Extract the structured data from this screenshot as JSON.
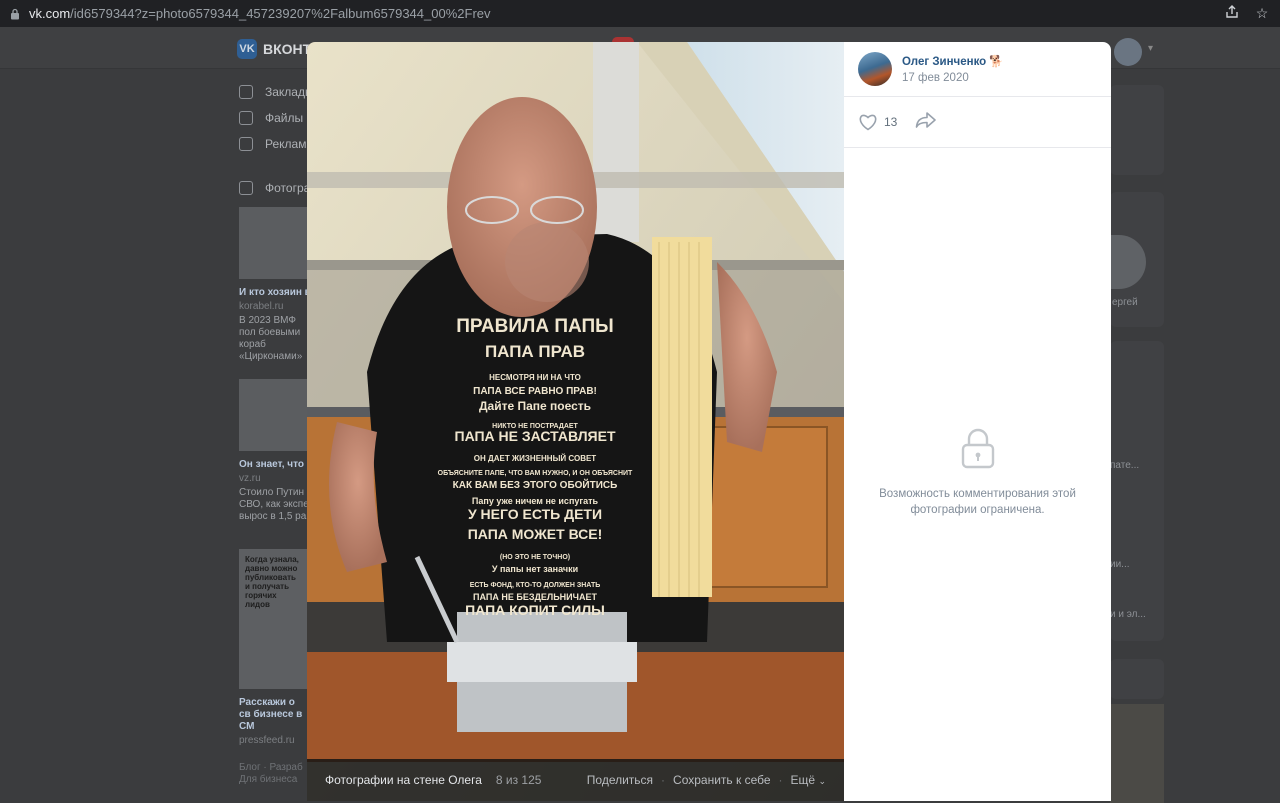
{
  "browser": {
    "url_host": "vk.com",
    "url_rest": "/id6579344?z=photo6579344_457239207%2Falbum6579344_00%2Frev"
  },
  "page": {
    "logo_text": "ВКОНТ",
    "menu": [
      "Закладк",
      "Файлы",
      "Реклам",
      "Фотогра"
    ],
    "ads": [
      {
        "title": "И кто хозяин в",
        "source": "korabel.ru",
        "text": "В 2023 ВМФ пол боевыми кораб «Цирконами»"
      },
      {
        "title": "Он знает, что",
        "source": "vz.ru",
        "text": "Стоило Путин СВО, как экспе вырос в 1,5 ра"
      },
      {
        "title": "Расскажи о св бизнесе в СМ",
        "source": "pressfeed.ru",
        "text": "",
        "promo": "Когда узнала, давно можно публиковать и получать горячих лидов"
      }
    ],
    "footer_links": "Блог · Разраб Для бизнеса",
    "right_snippets": [
      "ергей",
      "пате...",
      "ии...",
      "и и эл..."
    ]
  },
  "viewer": {
    "album_title": "Фотографии на стене Олега",
    "counter": "8 из 125",
    "share_label": "Поделиться",
    "save_label": "Сохранить к себе",
    "more_label": "Ещё",
    "author_name": "Олег Зинченко",
    "author_emoji": "🐕",
    "post_date": "17 фев 2020",
    "likes_count": "13",
    "comments_restricted_text": "Возможность комментирования этой фотографии ограничена.",
    "shirt_lines": [
      "ПРАВИЛА ПАПЫ",
      "ПАПА ПРАВ",
      "НЕСМОТРЯ НИ НА ЧТО",
      "ПАПА ВСЕ РАВНО ПРАВ!",
      "Дайте Папе поесть",
      "НИКТО НЕ ПОСТРАДАЕТ",
      "ПАПА НЕ ЗАСТАВЛЯЕТ",
      "ОН ДАЕТ ЖИЗНЕННЫЙ СОВЕТ",
      "ОБЪЯСНИТЕ ПАПЕ, ЧТО ВАМ НУЖНО, И ОН ОБЪЯСНИТ",
      "КАК ВАМ БЕЗ ЭТОГО ОБОЙТИСЬ",
      "Папу уже ничем не испугать",
      "У НЕГО ЕСТЬ ДЕТИ",
      "ПАПА МОЖЕТ ВСЕ!",
      "(НО ЭТО НЕ ТОЧНО)",
      "У папы нет заначки",
      "ЕСТЬ ФОНД, КТО-ТО ДОЛЖЕН ЗНАТЬ",
      "ПАПА НЕ БЕЗДЕЛЬНИЧАЕТ",
      "ПАПА КОПИТ СИЛЫ"
    ]
  }
}
